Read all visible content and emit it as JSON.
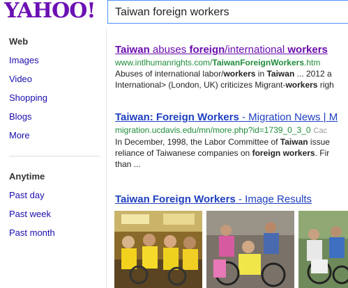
{
  "header": {
    "logo_text": "YAHOO!",
    "search_value": "Taiwan foreign workers"
  },
  "sidebar": {
    "items": [
      {
        "label": "Web"
      },
      {
        "label": "Images"
      },
      {
        "label": "Video"
      },
      {
        "label": "Shopping"
      },
      {
        "label": "Blogs"
      },
      {
        "label": "More"
      }
    ],
    "time_heading": "Anytime",
    "time_items": [
      {
        "label": "Past day"
      },
      {
        "label": "Past week"
      },
      {
        "label": "Past month"
      }
    ]
  },
  "results": [
    {
      "title_parts": [
        "Taiwan",
        " abuses ",
        "foreign",
        "/international ",
        "workers"
      ],
      "url_parts": [
        "www.intlhumanrights.com/",
        "Taiwan",
        "Foreign",
        "Workers",
        ".htm"
      ],
      "snippet_line1": [
        "Abuses of international labor/",
        "workers",
        " in ",
        "Taiwan",
        " ... 2012 a"
      ],
      "snippet_line2": [
        "International> (London, UK) criticizes Migrant-",
        "workers",
        " righ"
      ]
    },
    {
      "title_parts": [
        "Taiwan: Foreign Workers",
        " - Migration News | M"
      ],
      "url_text": "migration.ucdavis.edu/mn/more.php?id=1739_0_3_0",
      "cache_label": "Cac",
      "snippet_line1": [
        "In December, 1998, the Labor Committee of ",
        "Taiwan",
        " issue"
      ],
      "snippet_line2": [
        "reliance of Taiwanese companies on ",
        "foreign workers",
        ". Fir"
      ],
      "snippet_line3": [
        "than ..."
      ]
    }
  ],
  "image_results": {
    "title_bold": "Taiwan Foreign Workers",
    "title_rest": " - Image Results"
  },
  "colors": {
    "brand": "#6b11b3",
    "link": "#1f3fbf",
    "visited": "#6a0dad",
    "url_green": "#1e8c3a"
  }
}
